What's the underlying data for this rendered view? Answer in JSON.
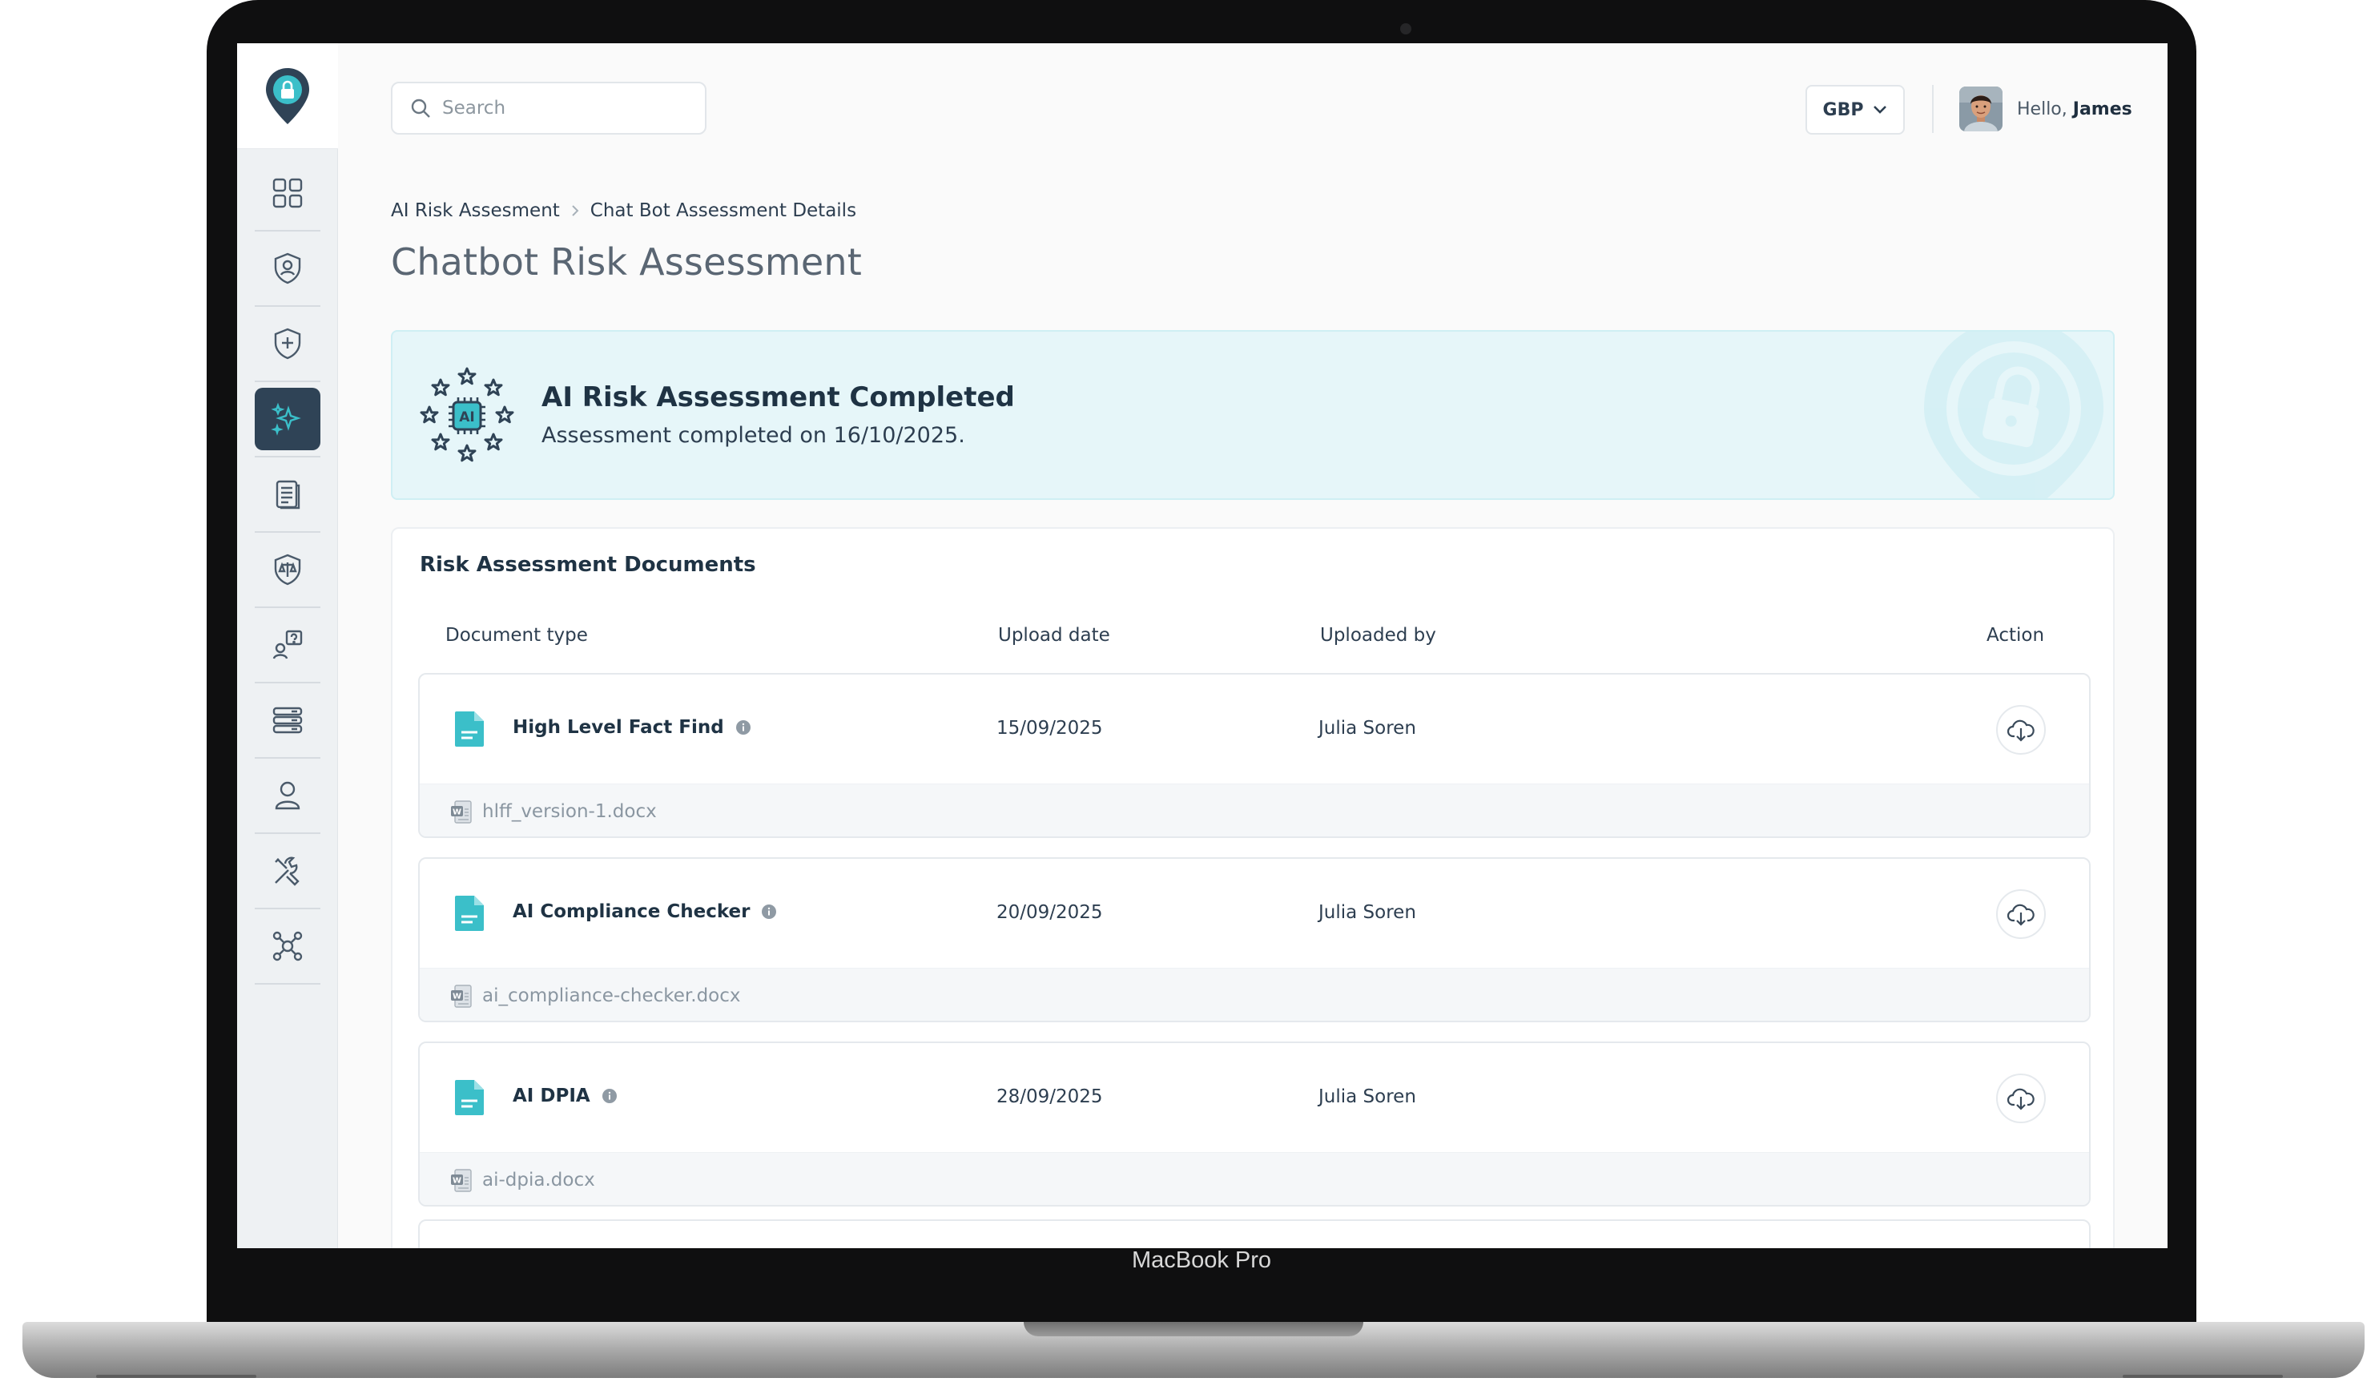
{
  "device": {
    "label": "MacBook Pro"
  },
  "search": {
    "placeholder": "Search"
  },
  "header": {
    "currency": "GBP",
    "greeting_prefix": "Hello,",
    "user_name": "James"
  },
  "sidebar": {
    "items": [
      {
        "icon": "dashboard-grid-icon"
      },
      {
        "icon": "user-shield-icon"
      },
      {
        "icon": "medical-shield-icon"
      },
      {
        "icon": "ai-sparkle-icon",
        "active": true
      },
      {
        "icon": "document-list-icon"
      },
      {
        "icon": "scales-shield-icon"
      },
      {
        "icon": "user-question-icon"
      },
      {
        "icon": "database-list-icon"
      },
      {
        "icon": "user-icon"
      },
      {
        "icon": "tools-icon"
      },
      {
        "icon": "network-icon"
      }
    ]
  },
  "breadcrumb": {
    "items": [
      "AI Risk Assesment",
      "Chat Bot Assessment Details"
    ]
  },
  "page": {
    "title": "Chatbot Risk Assessment"
  },
  "banner": {
    "title": "AI Risk Assessment Completed",
    "subtitle": "Assessment completed on 16/10/2025.",
    "badge_text": "AI"
  },
  "documents": {
    "title": "Risk Assessment Documents",
    "columns": [
      "Document type",
      "Upload date",
      "Uploaded by",
      "Action"
    ],
    "rows": [
      {
        "type": "High Level Fact Find",
        "date": "15/09/2025",
        "uploaded_by": "Julia Soren",
        "file": "hlff_version-1.docx"
      },
      {
        "type": "AI Compliance Checker",
        "date": "20/09/2025",
        "uploaded_by": "Julia Soren",
        "file": "ai_compliance-checker.docx"
      },
      {
        "type": "AI DPIA",
        "date": "28/09/2025",
        "uploaded_by": "Julia Soren",
        "file": "ai-dpia.docx"
      }
    ]
  },
  "colors": {
    "accent_teal": "#3bbfc9",
    "navy": "#2f4356",
    "banner_bg": "#e6f6f9"
  }
}
